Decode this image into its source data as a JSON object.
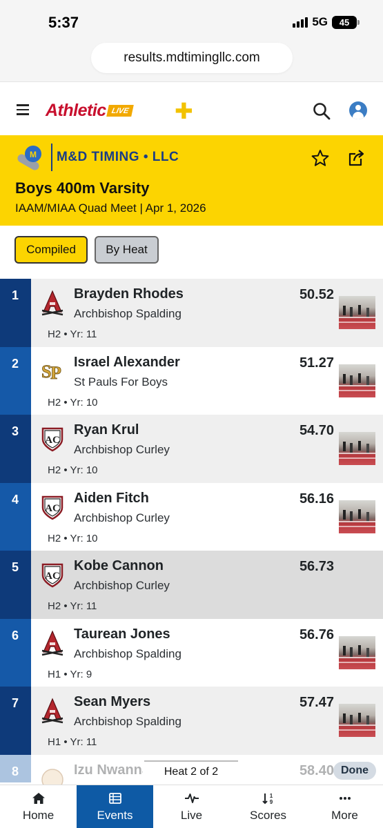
{
  "status_bar": {
    "time": "5:37",
    "network": "5G",
    "battery": "45"
  },
  "browser": {
    "url": "results.mdtimingllc.com"
  },
  "header": {
    "logo_text": "Athletic",
    "logo_badge": "LIVE"
  },
  "event": {
    "org_name": "M&D TIMING • LLC",
    "title": "Boys 400m Varsity",
    "subtitle": "IAAM/MIAA Quad Meet | Apr 1, 2026"
  },
  "view_toggle": {
    "compiled": "Compiled",
    "by_heat": "By Heat"
  },
  "results": [
    {
      "place": "1",
      "name": "Brayden Rhodes",
      "school": "Archbishop Spalding",
      "meta": "H2 • Yr: 11",
      "mark": "50.52",
      "logo": "spalding-logo"
    },
    {
      "place": "2",
      "name": "Israel Alexander",
      "school": "St Pauls For Boys",
      "meta": "H2 • Yr: 10",
      "mark": "51.27",
      "logo": "st-pauls-logo"
    },
    {
      "place": "3",
      "name": "Ryan Krul",
      "school": "Archbishop Curley",
      "meta": "H2 • Yr: 10",
      "mark": "54.70",
      "logo": "curley-logo"
    },
    {
      "place": "4",
      "name": "Aiden Fitch",
      "school": "Archbishop Curley",
      "meta": "H2 • Yr: 10",
      "mark": "56.16",
      "logo": "curley-logo"
    },
    {
      "place": "5",
      "name": "Kobe Cannon",
      "school": "Archbishop Curley",
      "meta": "H2 • Yr: 11",
      "mark": "56.73",
      "logo": "curley-logo"
    },
    {
      "place": "6",
      "name": "Taurean Jones",
      "school": "Archbishop Spalding",
      "meta": "H1 • Yr: 9",
      "mark": "56.76",
      "logo": "spalding-logo"
    },
    {
      "place": "7",
      "name": "Sean Myers",
      "school": "Archbishop Spalding",
      "meta": "H1 • Yr: 11",
      "mark": "57.47",
      "logo": "spalding-logo"
    },
    {
      "place": "8",
      "name": "Izu Nwanna",
      "school": "",
      "meta": "",
      "mark": "58.40",
      "logo": "school-logo"
    }
  ],
  "heat_popup": {
    "label": "Heat 2 of 2",
    "done": "Done"
  },
  "bottom_nav": [
    {
      "label": "Home",
      "icon": "home-icon"
    },
    {
      "label": "Events",
      "icon": "events-icon",
      "active": true
    },
    {
      "label": "Live",
      "icon": "live-icon"
    },
    {
      "label": "Scores",
      "icon": "scores-icon"
    },
    {
      "label": "More",
      "icon": "more-icon"
    }
  ],
  "colors": {
    "accent_yellow": "#fcd401",
    "primary_blue": "#0e5aa5",
    "place_dark": "#0e3a7a",
    "place_light": "#1559a8",
    "brand_red": "#c8102e"
  }
}
